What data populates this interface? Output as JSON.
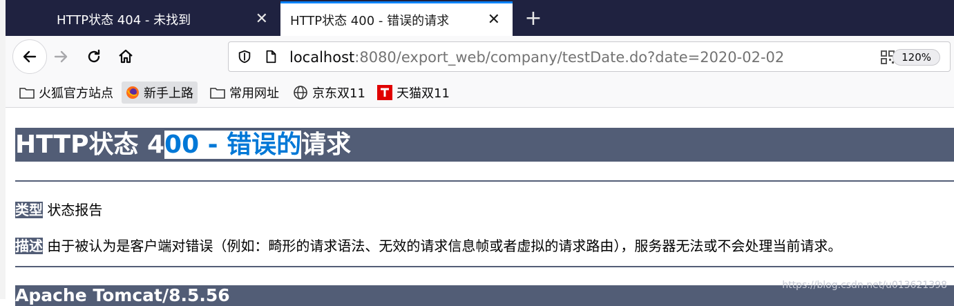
{
  "tabs": [
    {
      "title": "HTTP状态 404 - 未找到",
      "active": false
    },
    {
      "title": "HTTP状态 400 - 错误的请求",
      "active": true
    }
  ],
  "tab_close_glyph": "✕",
  "new_tab_glyph": "+",
  "nav": {
    "url_host": "localhost",
    "url_rest": ":8080/export_web/company/testDate.do?date=2020-02-02",
    "zoom": "120%"
  },
  "bookmarks": [
    {
      "label": "火狐官方站点",
      "icon": "folder-icon"
    },
    {
      "label": "新手上路",
      "icon": "firefox-icon"
    },
    {
      "label": "常用网址",
      "icon": "folder-icon"
    },
    {
      "label": "京东双11",
      "icon": "globe-icon"
    },
    {
      "label": "天猫双11",
      "icon": "tmall-icon"
    }
  ],
  "page": {
    "heading_before": "HTTP状态 4",
    "heading_selected": "00 - 错误的",
    "heading_after": "请求",
    "type_label": "类型",
    "type_value": " 状态报告",
    "desc_label": "描述",
    "desc_value": " 由于被认为是客户端对错误（例如：畸形的请求语法、无效的请求信息帧或者虚拟的请求路由），服务器无法或不会处理当前请求。",
    "footer": "Apache Tomcat/8.5.56"
  },
  "watermark": "https://blog.csdn.net/u013621398",
  "colors": {
    "tomcat_header": "#525d76",
    "selection_text": "#0078d7",
    "tabbar": "#1f2240",
    "tab_accent": "#0a84ff"
  }
}
